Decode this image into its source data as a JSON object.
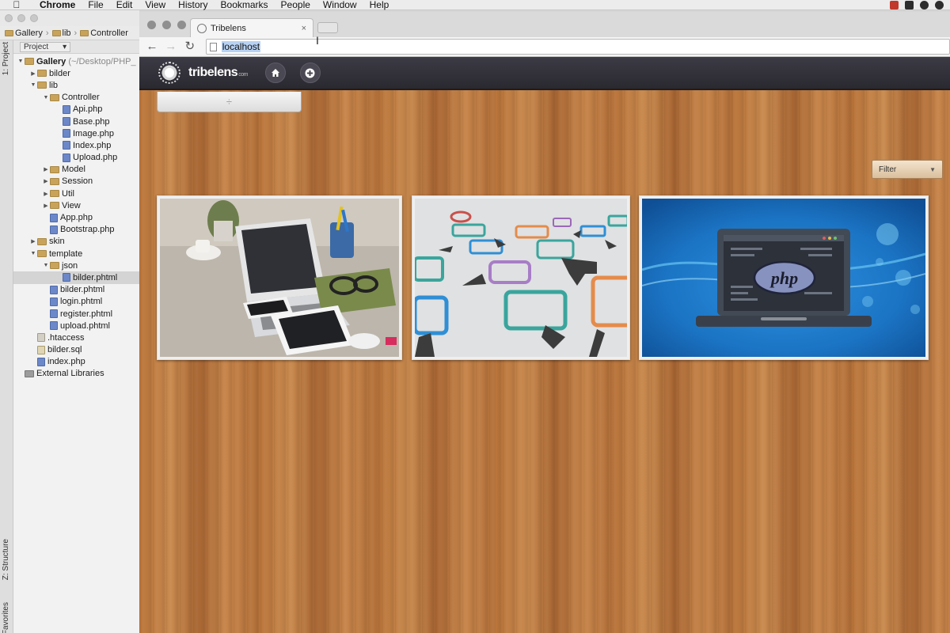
{
  "menubar": {
    "items": [
      "Chrome",
      "File",
      "Edit",
      "View",
      "History",
      "Bookmarks",
      "People",
      "Window",
      "Help"
    ]
  },
  "ide": {
    "breadcrumb": [
      "Gallery",
      "lib",
      "Controller"
    ],
    "panel_title": "Project",
    "side_tabs": {
      "project": "1: Project",
      "structure": "Z: Structure",
      "favorites": "Favorites"
    },
    "tree": [
      {
        "label": "Gallery",
        "extra": "(~/Desktop/PHP_",
        "type": "folder",
        "depth": 0,
        "open": true,
        "bold": true
      },
      {
        "label": "bilder",
        "type": "folder",
        "depth": 1,
        "open": false
      },
      {
        "label": "lib",
        "type": "folder",
        "depth": 1,
        "open": true
      },
      {
        "label": "Controller",
        "type": "folder",
        "depth": 2,
        "open": true
      },
      {
        "label": "Api.php",
        "type": "php",
        "depth": 3
      },
      {
        "label": "Base.php",
        "type": "php",
        "depth": 3
      },
      {
        "label": "Image.php",
        "type": "php",
        "depth": 3
      },
      {
        "label": "Index.php",
        "type": "php",
        "depth": 3
      },
      {
        "label": "Upload.php",
        "type": "php",
        "depth": 3
      },
      {
        "label": "Model",
        "type": "folder",
        "depth": 2,
        "open": false
      },
      {
        "label": "Session",
        "type": "folder",
        "depth": 2,
        "open": false
      },
      {
        "label": "Util",
        "type": "folder",
        "depth": 2,
        "open": false
      },
      {
        "label": "View",
        "type": "folder",
        "depth": 2,
        "open": false
      },
      {
        "label": "App.php",
        "type": "php",
        "depth": 2
      },
      {
        "label": "Bootstrap.php",
        "type": "php",
        "depth": 2
      },
      {
        "label": "skin",
        "type": "folder",
        "depth": 1,
        "open": false
      },
      {
        "label": "template",
        "type": "folder",
        "depth": 1,
        "open": true
      },
      {
        "label": "json",
        "type": "folder",
        "depth": 2,
        "open": true
      },
      {
        "label": "bilder.phtml",
        "type": "php",
        "depth": 3,
        "selected": true
      },
      {
        "label": "bilder.phtml",
        "type": "php",
        "depth": 2
      },
      {
        "label": "login.phtml",
        "type": "php",
        "depth": 2
      },
      {
        "label": "register.phtml",
        "type": "php",
        "depth": 2
      },
      {
        "label": "upload.phtml",
        "type": "php",
        "depth": 2
      },
      {
        "label": ".htaccess",
        "type": "plain",
        "depth": 1
      },
      {
        "label": "bilder.sql",
        "type": "sql",
        "depth": 1
      },
      {
        "label": "index.php",
        "type": "php",
        "depth": 1
      },
      {
        "label": "External Libraries",
        "type": "lib",
        "depth": 0
      }
    ]
  },
  "browser": {
    "tab_title": "Tribelens",
    "tab_close": "×",
    "url": "localhost"
  },
  "app": {
    "logo_text": "tribelens",
    "logo_suffix": "com",
    "drawer_handle": "÷",
    "filter_label": "Filter",
    "cards": [
      {
        "name": "desk-laptop-photo"
      },
      {
        "name": "flowchart-photo"
      },
      {
        "name": "php-laptop-illustration",
        "badge": "php"
      }
    ]
  },
  "colors": {
    "header_bg": "#2f2e36",
    "wood": "#b97a42",
    "php_blue": "#1b74c4"
  }
}
